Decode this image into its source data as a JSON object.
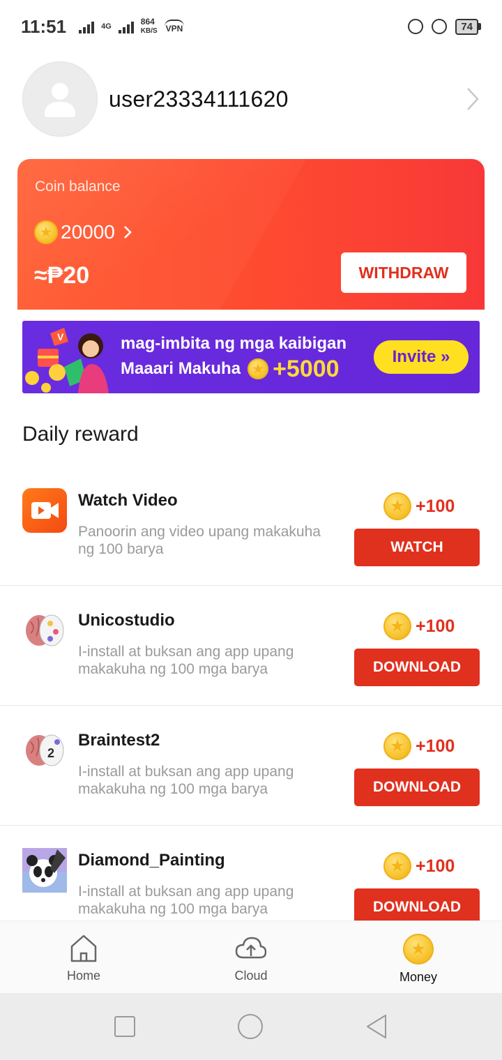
{
  "status_bar": {
    "time": "11:51",
    "network": "4G",
    "speed_value": "864",
    "speed_unit": "KB/S",
    "vpn": "VPN",
    "battery": "74"
  },
  "profile": {
    "username": "user23334111620"
  },
  "coin_card": {
    "label": "Coin balance",
    "coins": "20000",
    "peso_value": "≈₱20",
    "withdraw_label": "WITHDRAW"
  },
  "invite_banner": {
    "line1": "mag-imbita ng mga kaibigan",
    "line2": "Maaari Makuha",
    "bonus": "+5000",
    "button_label": "Invite »"
  },
  "daily_reward": {
    "title": "Daily reward",
    "items": [
      {
        "name": "Watch Video",
        "desc": "Panoorin ang video upang makakuha ng 100 barya",
        "amount": "+100",
        "button": "WATCH"
      },
      {
        "name": "Unicostudio",
        "desc": "I-install at buksan ang app upang makakuha ng 100 mga barya",
        "amount": "+100",
        "button": "DOWNLOAD"
      },
      {
        "name": "Braintest2",
        "desc": "I-install at buksan ang app upang makakuha ng 100 mga barya",
        "amount": "+100",
        "button": "DOWNLOAD"
      },
      {
        "name": "Diamond_Painting",
        "desc": "I-install at buksan ang app upang makakuha ng 100 mga barya",
        "amount": "+100",
        "button": "DOWNLOAD"
      }
    ]
  },
  "bottom_nav": {
    "items": [
      {
        "label": "Home",
        "icon": "home-icon"
      },
      {
        "label": "Cloud",
        "icon": "cloud-upload-icon"
      },
      {
        "label": "Money",
        "icon": "coin-icon",
        "active": true
      }
    ]
  },
  "colors": {
    "accent": "#e0301e",
    "card_gradient_start": "#ff5a2e",
    "card_gradient_end": "#f83838",
    "banner_purple": "#6627d9",
    "invite_yellow": "#ffe021"
  }
}
